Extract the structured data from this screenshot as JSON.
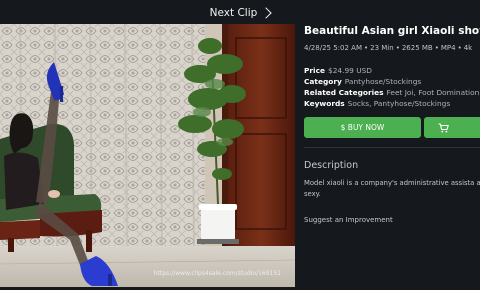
{
  "topbar": {
    "next_clip_label": "Next Clip"
  },
  "media": {
    "watermark": "https://www.clips4sale.com/studio/169151"
  },
  "clip": {
    "title": "Beautiful Asian girl Xiaoli shows her se",
    "date": "4/28/25 5:02 AM",
    "duration": "23 Min",
    "size": "2625 MB",
    "format": "MP4",
    "resolution": "4k",
    "separator": "•"
  },
  "details": {
    "price_label": "Price",
    "price_value": "$24.99 USD",
    "category_label": "Category",
    "category_value": "Pantyhose/Stockings",
    "related_label": "Related Categories",
    "related_value": "Feet Joi, Foot Domination, Foo",
    "keywords_label": "Keywords",
    "keywords_value": "Socks, Pantyhose/Stockings"
  },
  "actions": {
    "buy_label": "$ BUY NOW"
  },
  "description": {
    "heading": "Description",
    "text": "Model xiaoli is a company's administrative assista and sexy."
  },
  "footer": {
    "suggest_label": "Suggest an Improvement"
  },
  "colors": {
    "background": "#15181c",
    "accent_green": "#4caf50",
    "divider": "#2e3339"
  },
  "icons": {
    "next": "chevron-right-icon",
    "cart": "cart-icon"
  }
}
